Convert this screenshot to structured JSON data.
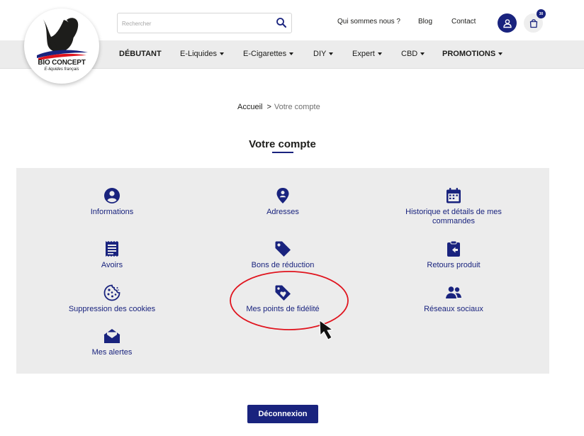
{
  "brand": {
    "name": "BIO CONCEPT",
    "tagline": "E-liquides français"
  },
  "search": {
    "placeholder": "Rechercher",
    "value": ""
  },
  "header_links": [
    {
      "label": "Qui sommes nous ?"
    },
    {
      "label": "Blog"
    },
    {
      "label": "Contact"
    }
  ],
  "cart": {
    "count": "30"
  },
  "nav": {
    "items": [
      {
        "label": "DÉBUTANT",
        "bold": true,
        "dropdown": false
      },
      {
        "label": "E-Liquides",
        "bold": false,
        "dropdown": true
      },
      {
        "label": "E-Cigarettes",
        "bold": false,
        "dropdown": true
      },
      {
        "label": "DIY",
        "bold": false,
        "dropdown": true
      },
      {
        "label": "Expert",
        "bold": false,
        "dropdown": true
      },
      {
        "label": "CBD",
        "bold": false,
        "dropdown": true
      },
      {
        "label": "PROMOTIONS",
        "bold": true,
        "dropdown": true
      }
    ]
  },
  "breadcrumb": {
    "home": "Accueil",
    "separator": ">",
    "current": "Votre compte"
  },
  "page": {
    "title": "Votre compte"
  },
  "account_tiles": [
    {
      "label": "Informations",
      "icon": "user-circle-icon"
    },
    {
      "label": "Adresses",
      "icon": "map-marker-user-icon"
    },
    {
      "label": "Historique et détails de mes commandes",
      "icon": "calendar-icon"
    },
    {
      "label": "Avoirs",
      "icon": "receipt-icon"
    },
    {
      "label": "Bons de réduction",
      "icon": "tag-icon"
    },
    {
      "label": "Retours produit",
      "icon": "clipboard-return-icon"
    },
    {
      "label": "Suppression des cookies",
      "icon": "cookie-icon"
    },
    {
      "label": "Mes points de fidélité",
      "icon": "heart-tag-icon"
    },
    {
      "label": "Réseaux sociaux",
      "icon": "users-icon"
    },
    {
      "label": "Mes alertes",
      "icon": "envelope-open-icon"
    }
  ],
  "logout": {
    "label": "Déconnexion"
  },
  "colors": {
    "primary": "#19237e",
    "panel_background": "#ececec",
    "nav_background": "#ececec",
    "annotation": "#e0141e"
  }
}
